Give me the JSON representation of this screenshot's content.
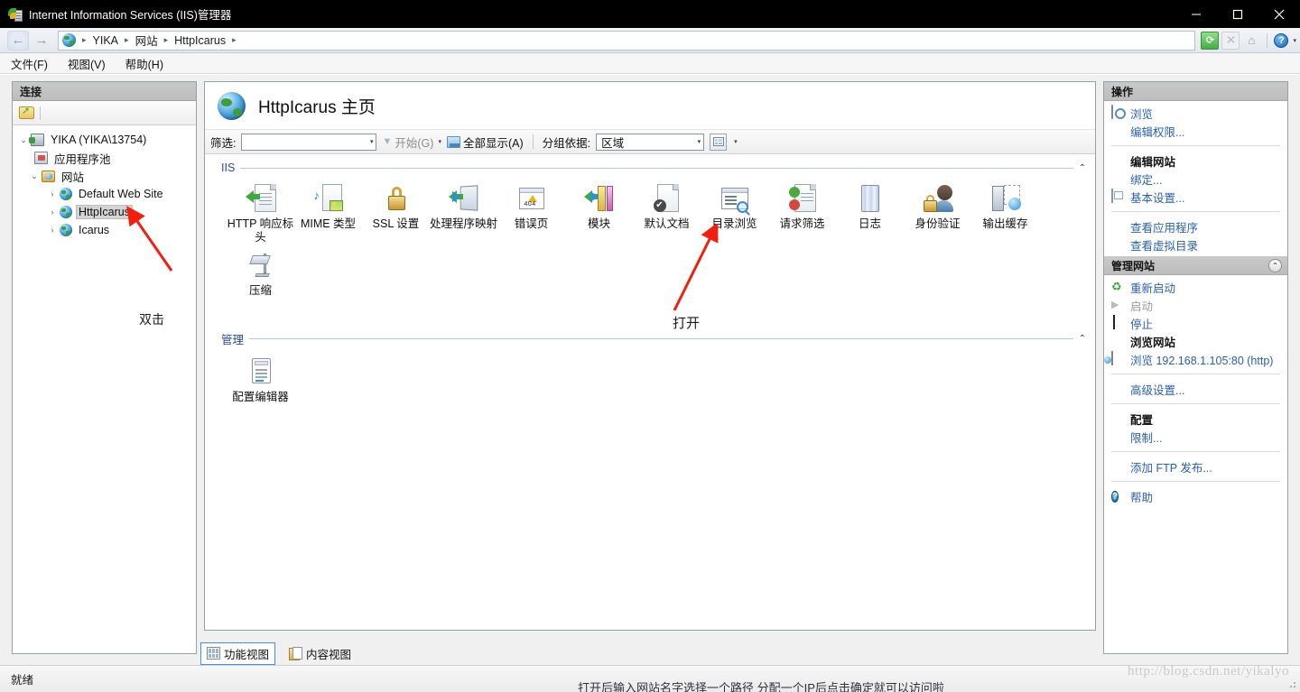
{
  "window": {
    "title": "Internet Information Services (IIS)管理器",
    "app_icon": "iis-server-icon",
    "minimize": "—",
    "maximize": "□",
    "close": "✕"
  },
  "addressbar": {
    "back": "←",
    "forward": "→",
    "site_icon": "globe-icon",
    "crumbs": [
      "YIKA",
      "网站",
      "HttpIcarus"
    ],
    "separator": "▸",
    "tools": [
      {
        "name": "refresh-icon",
        "glyph": "⟳"
      },
      {
        "name": "stop-icon",
        "glyph": "✕"
      },
      {
        "name": "home-icon",
        "glyph": "⌂"
      },
      {
        "name": "help-icon",
        "glyph": "?"
      }
    ],
    "help_caret": "▾"
  },
  "menubar": {
    "items": [
      "文件(F)",
      "视图(V)",
      "帮助(H)"
    ]
  },
  "connections": {
    "header": "连接",
    "tree": [
      {
        "label": "YIKA (YIKA\\13754)",
        "twisty": "⌄",
        "icon": "server-icon",
        "indent": 0,
        "selected": false
      },
      {
        "label": "应用程序池",
        "twisty": "",
        "icon": "apppool-icon",
        "indent": 1,
        "selected": false
      },
      {
        "label": "网站",
        "twisty": "⌄",
        "icon": "sites-folder-icon",
        "indent": 1,
        "selected": false
      },
      {
        "label": "Default Web Site",
        "twisty": "›",
        "icon": "site-globe-icon",
        "indent": 2,
        "selected": false
      },
      {
        "label": "HttpIcarus",
        "twisty": "›",
        "icon": "site-globe-icon",
        "indent": 2,
        "selected": true
      },
      {
        "label": "Icarus",
        "twisty": "›",
        "icon": "site-globe-icon",
        "indent": 2,
        "selected": false
      }
    ],
    "annotation": "双击"
  },
  "page": {
    "title": "HttpIcarus 主页",
    "icon": "site-globe-large-icon"
  },
  "filterbar": {
    "filter_label": "筛选:",
    "filter_value": "",
    "filter_placeholder": "",
    "go_label": "开始(G)",
    "showall_label": "全部显示(A)",
    "groupby_label": "分组依据:",
    "groupby_value": "区域",
    "dropdown_arrow": "▾",
    "viewmode": "grid-view-icon"
  },
  "sections": [
    {
      "title": "IIS",
      "chevron": "⌃",
      "items": [
        {
          "label": "HTTP 响应标头",
          "icon": "http-response-headers-icon"
        },
        {
          "label": "MIME 类型",
          "icon": "mime-types-icon"
        },
        {
          "label": "SSL 设置",
          "icon": "ssl-settings-icon"
        },
        {
          "label": "处理程序映射",
          "icon": "handler-mappings-icon"
        },
        {
          "label": "错误页",
          "icon": "error-pages-icon"
        },
        {
          "label": "模块",
          "icon": "modules-icon"
        },
        {
          "label": "默认文档",
          "icon": "default-document-icon"
        },
        {
          "label": "目录浏览",
          "icon": "directory-browsing-icon"
        },
        {
          "label": "请求筛选",
          "icon": "request-filtering-icon"
        },
        {
          "label": "日志",
          "icon": "logging-icon"
        },
        {
          "label": "身份验证",
          "icon": "authentication-icon"
        },
        {
          "label": "输出缓存",
          "icon": "output-caching-icon"
        },
        {
          "label": "压缩",
          "icon": "compression-icon"
        }
      ]
    },
    {
      "title": "管理",
      "chevron": "⌃",
      "items": [
        {
          "label": "配置编辑器",
          "icon": "configuration-editor-icon"
        }
      ]
    }
  ],
  "annotations": {
    "open_label": "打开",
    "arrow_color": "#f02010"
  },
  "viewtabs": [
    {
      "label": "功能视图",
      "icon": "feature-view-icon",
      "selected": true
    },
    {
      "label": "内容视图",
      "icon": "content-view-icon",
      "selected": false
    }
  ],
  "actions": {
    "header": "操作",
    "groups": [
      {
        "rows": [
          {
            "label": "浏览",
            "icon": "browse-icon",
            "disabled": false,
            "bold": false
          },
          {
            "label": "编辑权限...",
            "icon": "",
            "disabled": false,
            "bold": false
          }
        ]
      },
      {
        "rows": [
          {
            "label": "编辑网站",
            "icon": "",
            "disabled": false,
            "bold": true
          },
          {
            "label": "绑定...",
            "icon": "",
            "disabled": false,
            "bold": false
          },
          {
            "label": "基本设置...",
            "icon": "basic-settings-icon",
            "disabled": false,
            "bold": false
          }
        ]
      },
      {
        "rows": [
          {
            "label": "查看应用程序",
            "icon": "",
            "disabled": false,
            "bold": false
          },
          {
            "label": "查看虚拟目录",
            "icon": "",
            "disabled": false,
            "bold": false
          }
        ]
      }
    ],
    "manage_header": "管理网站",
    "manage_collapse": "⌃",
    "manage_rows": [
      {
        "label": "重新启动",
        "icon": "restart-icon",
        "disabled": false,
        "bold": false
      },
      {
        "label": "启动",
        "icon": "start-icon",
        "disabled": true,
        "bold": false
      },
      {
        "label": "停止",
        "icon": "stop-square-icon",
        "disabled": false,
        "bold": false
      }
    ],
    "browse_header": "浏览网站",
    "browse_rows": [
      {
        "label": "浏览 192.168.1.105:80 (http)",
        "icon": "browse-site-icon",
        "disabled": false,
        "bold": false
      }
    ],
    "advanced_rows": [
      {
        "label": "高级设置...",
        "icon": "",
        "disabled": false,
        "bold": false
      }
    ],
    "config_header": "配置",
    "config_rows": [
      {
        "label": "限制...",
        "icon": "",
        "disabled": false,
        "bold": false
      }
    ],
    "ftp_rows": [
      {
        "label": "添加 FTP 发布...",
        "icon": "",
        "disabled": false,
        "bold": false
      }
    ],
    "help_rows": [
      {
        "label": "帮助",
        "icon": "help-circle-icon",
        "disabled": false,
        "bold": false
      }
    ]
  },
  "statusbar": {
    "text": "就绪"
  },
  "background": {
    "watermark": "http://blog.csdn.net/yikalyo",
    "bottom_text": "打开后输入网站名字选择一个路径 分配一个IP后点击确定就可以访问啦"
  }
}
